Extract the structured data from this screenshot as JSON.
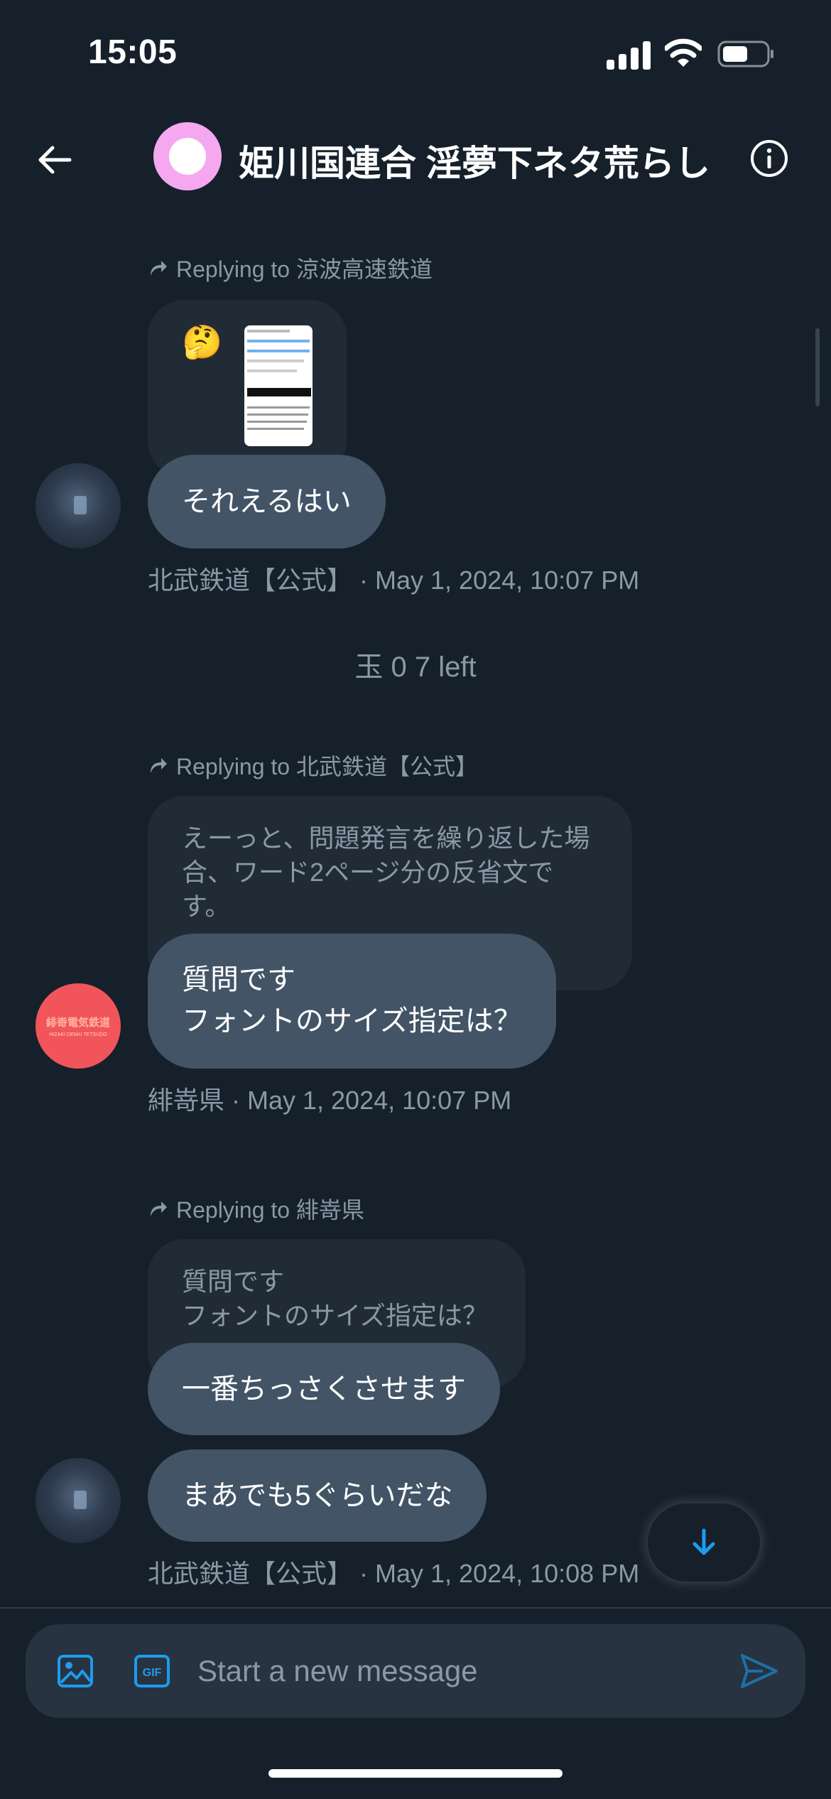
{
  "status_bar": {
    "time": "15:05",
    "icons": [
      "signal-icon",
      "wifi-icon",
      "battery-icon"
    ]
  },
  "header": {
    "title": "姫川国連合 淫夢下ネタ荒らし",
    "back_icon": "back-arrow-icon",
    "info_icon": "info-icon"
  },
  "messages": {
    "group1": {
      "replying_to": "Replying to 涼波高速鉄道",
      "emoji": "🤔",
      "bubble": "それえるはい",
      "meta": "北武鉄道【公式】 · May 1, 2024, 10:07 PM"
    },
    "system_note": "玉 0 7 left",
    "group2": {
      "replying_to": "Replying to 北武鉄道【公式】",
      "quoted_lines": [
        "えーっと、問題発言を繰り返した場",
        "合、ワード2ページ分の反省文で",
        "す。"
      ],
      "bubble_lines": [
        "質問です",
        "フォントのサイズ指定は？"
      ],
      "meta": "緋嵜県 · May 1, 2024, 10:07 PM",
      "avatar_logo": "緋嵜電気鉄道",
      "avatar_sub": "HIZAKI DENKI TETSUDO"
    },
    "group3": {
      "replying_to": "Replying to 緋嵜県",
      "quoted_lines": [
        "質問です",
        "フォントのサイズ指定は？"
      ],
      "bubble1": "一番ちっさくさせます",
      "bubble2": "まあでも5ぐらいだな",
      "meta": "北武鉄道【公式】 · May 1, 2024, 10:08 PM"
    }
  },
  "composer": {
    "placeholder": "Start a new message",
    "icons": [
      "image-icon",
      "gif-icon",
      "send-icon"
    ]
  },
  "colors": {
    "background": "#15202b",
    "bubble": "#425466",
    "quoted": "#202b36",
    "accent": "#1d9bf0",
    "muted_text": "#8b98a5"
  }
}
